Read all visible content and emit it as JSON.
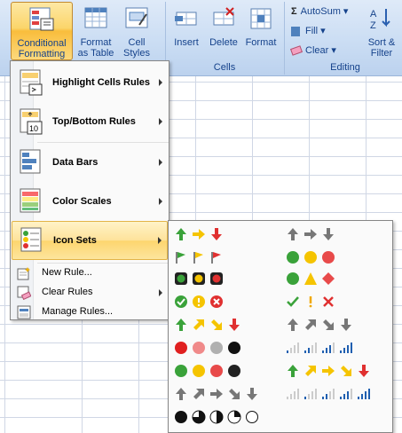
{
  "ribbon": {
    "conditional_formatting": "Conditional\nFormatting",
    "format_as_table": "Format\nas Table",
    "cell_styles": "Cell\nStyles",
    "insert": "Insert",
    "delete": "Delete",
    "format": "Format",
    "cells_group": "Cells",
    "autosum": "AutoSum",
    "fill": "Fill",
    "clear": "Clear",
    "sort_filter": "Sort &\nFilter",
    "editing_group": "Editing",
    "dropdown_glyph": "▾"
  },
  "menu": {
    "items": [
      {
        "label": "Highlight Cells Rules",
        "icon": "highlight-cells-icon"
      },
      {
        "label": "Top/Bottom Rules",
        "icon": "top-bottom-icon"
      },
      {
        "label": "Data Bars",
        "icon": "data-bars-icon"
      },
      {
        "label": "Color Scales",
        "icon": "color-scales-icon"
      },
      {
        "label": "Icon Sets",
        "icon": "icon-sets-icon"
      }
    ],
    "small_items": [
      {
        "label": "New Rule...",
        "icon": "new-rule-icon"
      },
      {
        "label": "Clear Rules",
        "icon": "clear-rules-icon"
      },
      {
        "label": "Manage Rules...",
        "icon": "manage-rules-icon"
      }
    ]
  },
  "icon_sets": {
    "left_column": [
      "3 Arrows (Colored)",
      "3 Flags",
      "3 Traffic Lights (Rimmed)",
      "3 Symbols (Circled)",
      "4 Arrows (Colored)",
      "Red To Black",
      "4 Traffic Lights",
      "5 Arrows (Gray)",
      "5 Quarters"
    ],
    "right_column": [
      "3 Arrows (Gray)",
      "3 Traffic Lights (Unrimmed)",
      "3 Signs",
      "3 Symbols (Uncircled)",
      "4 Arrows (Gray)",
      "4 Ratings",
      "5 Arrows (Colored)",
      "5 Ratings"
    ]
  },
  "colors": {
    "ribbon_top": "#dfeaf8",
    "active_orange": "#fdd56e",
    "green": "#3aa23a",
    "yellow": "#f5c400",
    "red": "#e03030"
  }
}
